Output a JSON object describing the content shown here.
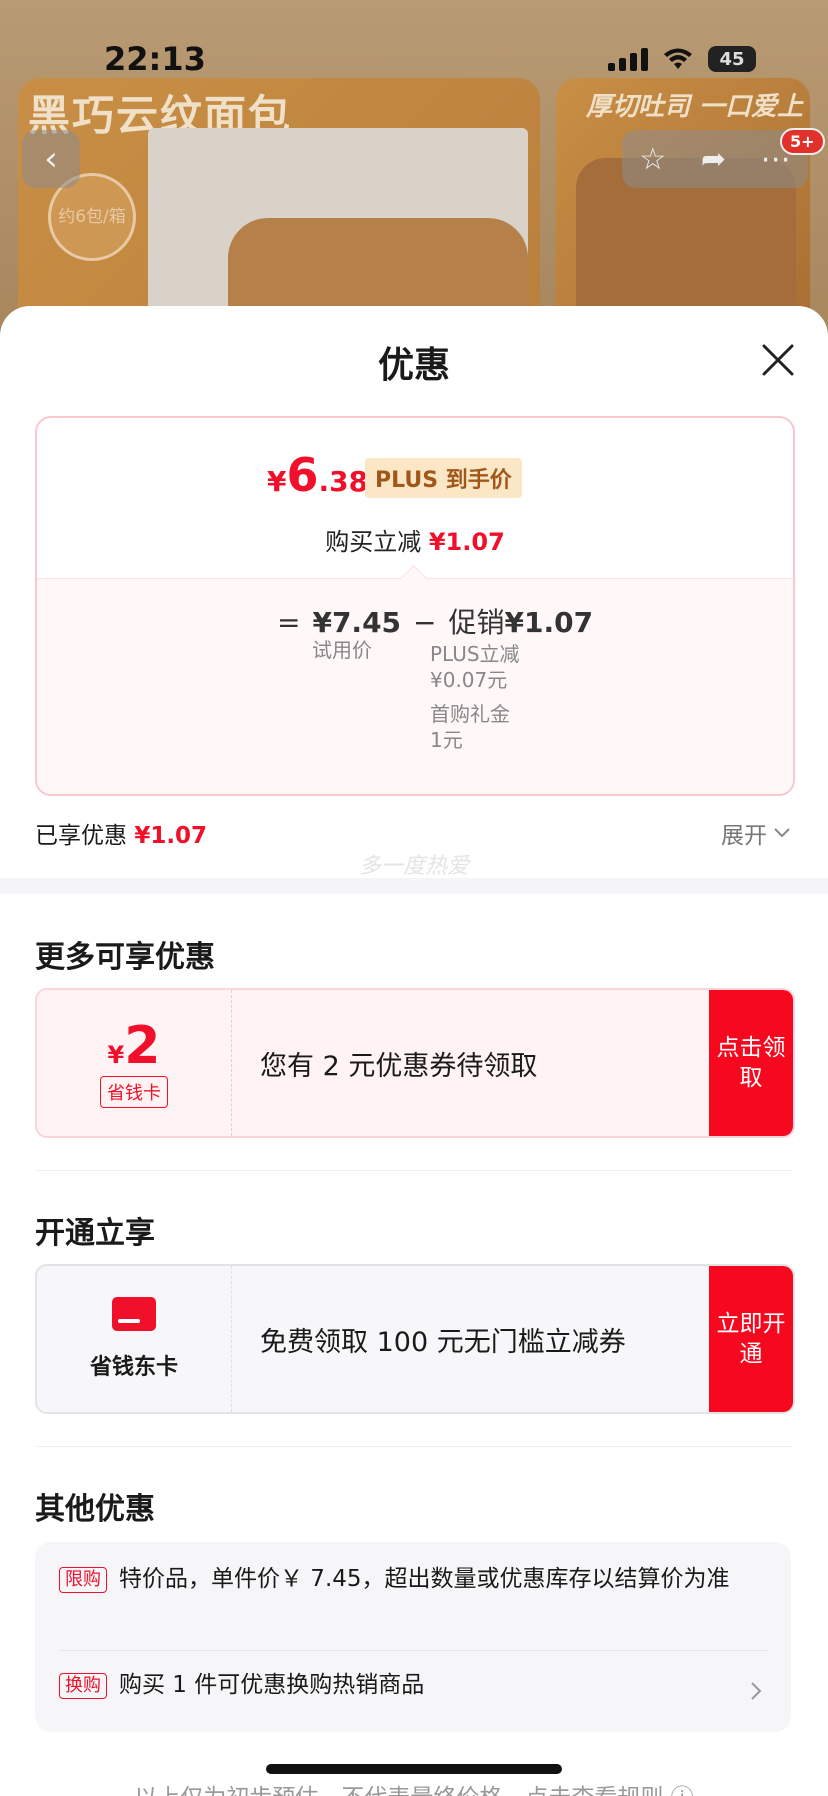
{
  "status": {
    "time": "22:13",
    "battery": "45"
  },
  "background": {
    "left_title": "黑巧云纹面包",
    "right_title": "厚切吐司 一口爱上",
    "badge": "约6包/箱",
    "notif_count": "5+"
  },
  "sheet": {
    "title": "优惠",
    "price": {
      "symbol": "¥",
      "integer": "6",
      "decimal": ".38",
      "tag": "PLUS 到手价"
    },
    "reduce": {
      "label": "购买立减",
      "value": "¥1.07"
    },
    "formula": {
      "eq": "=",
      "trial_price": "¥7.45",
      "minus": "−",
      "promo_label": "促销",
      "promo_value": "¥1.07",
      "trial_label": "试用价",
      "sub1": "PLUS立减",
      "sub1_val": "¥0.07元",
      "sub2": "首购礼金",
      "sub2_val": "1元"
    },
    "enjoyed": {
      "label": "已享优惠",
      "value": "¥1.07",
      "expand": "展开"
    },
    "watermark": "多一度热爱",
    "more": {
      "title": "更多可享优惠",
      "coupon": {
        "symbol": "¥",
        "amount": "2",
        "tag": "省钱卡",
        "text": "您有 2 元优惠券待领取",
        "button": "点击领取"
      }
    },
    "open": {
      "title": "开通立享",
      "card": {
        "name": "省钱东卡",
        "text": "免费领取 100 元无门槛立减券",
        "button": "立即开通"
      }
    },
    "other": {
      "title": "其他优惠",
      "rows": [
        {
          "tag": "限购",
          "text": "特价品，单件价￥ 7.45，超出数量或优惠库存以结算价为准"
        },
        {
          "tag": "换购",
          "text": "购买 1 件可优惠换购热销商品"
        }
      ]
    },
    "footer": "以上仅为初步预估，不代表最终价格，点击查看规则"
  }
}
